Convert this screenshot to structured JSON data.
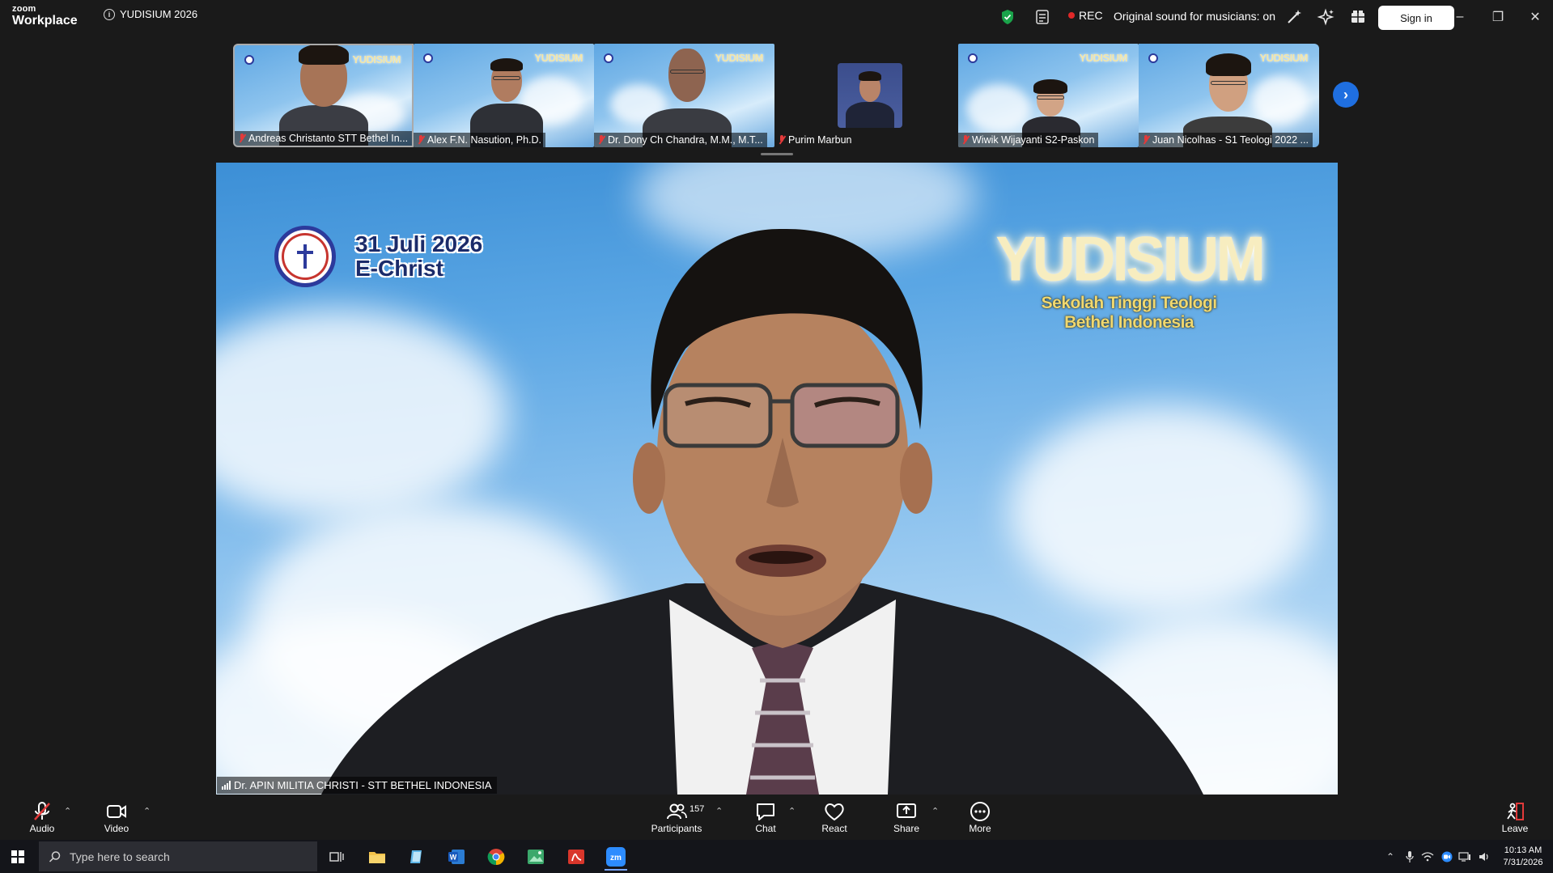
{
  "app": {
    "brand_small": "zoom",
    "brand_large": "Workplace"
  },
  "meeting": {
    "title": "YUDISIUM 2026"
  },
  "topbar": {
    "rec_label": "REC",
    "original_sound": "Original sound for musicians: on",
    "sign_in": "Sign in",
    "accent_green": "#1aa34a",
    "rec_color": "#e02828"
  },
  "thumbnails": [
    {
      "name": "Andreas Christanto STT Bethel In..."
    },
    {
      "name": "Alex F.N. Nasution, Ph.D."
    },
    {
      "name": "Dr. Dony Ch Chandra, M.M., M.T..."
    },
    {
      "name": "Purim Marbun"
    },
    {
      "name": "Wiwik Wijayanti S2-Paskon"
    },
    {
      "name": "Juan Nicolhas - S1 Teologi 2022 ..."
    }
  ],
  "background": {
    "date_line1": "31 Juli 2026",
    "date_line2": "E-Christ",
    "banner_title": "YUDISIUM",
    "banner_sub1": "Sekolah Tinggi Teologi",
    "banner_sub2": "Bethel Indonesia"
  },
  "main_speaker": {
    "name": "Dr. APIN MILITIA CHRISTI - STT BETHEL INDONESIA"
  },
  "toolbar": {
    "audio": "Audio",
    "video": "Video",
    "participants": "Participants",
    "participants_count": "157",
    "chat": "Chat",
    "react": "React",
    "share": "Share",
    "more": "More",
    "leave": "Leave"
  },
  "taskbar": {
    "search_placeholder": "Type here to search",
    "time": "10:13 AM",
    "date": "7/31/2026"
  }
}
